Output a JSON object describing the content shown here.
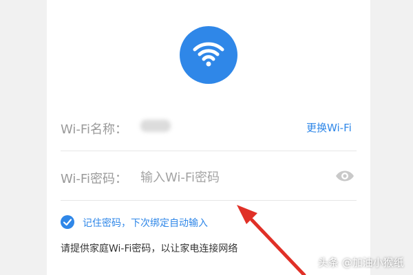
{
  "colors": {
    "accent": "#2f87e8",
    "page_background": "#f1f1f1",
    "card_background": "#ffffff",
    "label_gray": "#9a9a9a",
    "arrow_red": "#e03027"
  },
  "icons": {
    "header": "wifi-icon",
    "password_toggle": "eye-icon",
    "remember_check": "checkmark-icon"
  },
  "form": {
    "ssid_label": "Wi-Fi名称：",
    "change_wifi_label": "更换Wi-Fi",
    "password_label": "Wi-Fi密码：",
    "password_placeholder": "输入Wi-Fi密码",
    "password_value": "",
    "remember_label": "记住密码，下次绑定自动输入",
    "remember_checked": true,
    "hint_text": "请提供家庭Wi-Fi密码，以让家电连接网络"
  },
  "watermark": {
    "text": "头条 @加油小猴纸"
  }
}
